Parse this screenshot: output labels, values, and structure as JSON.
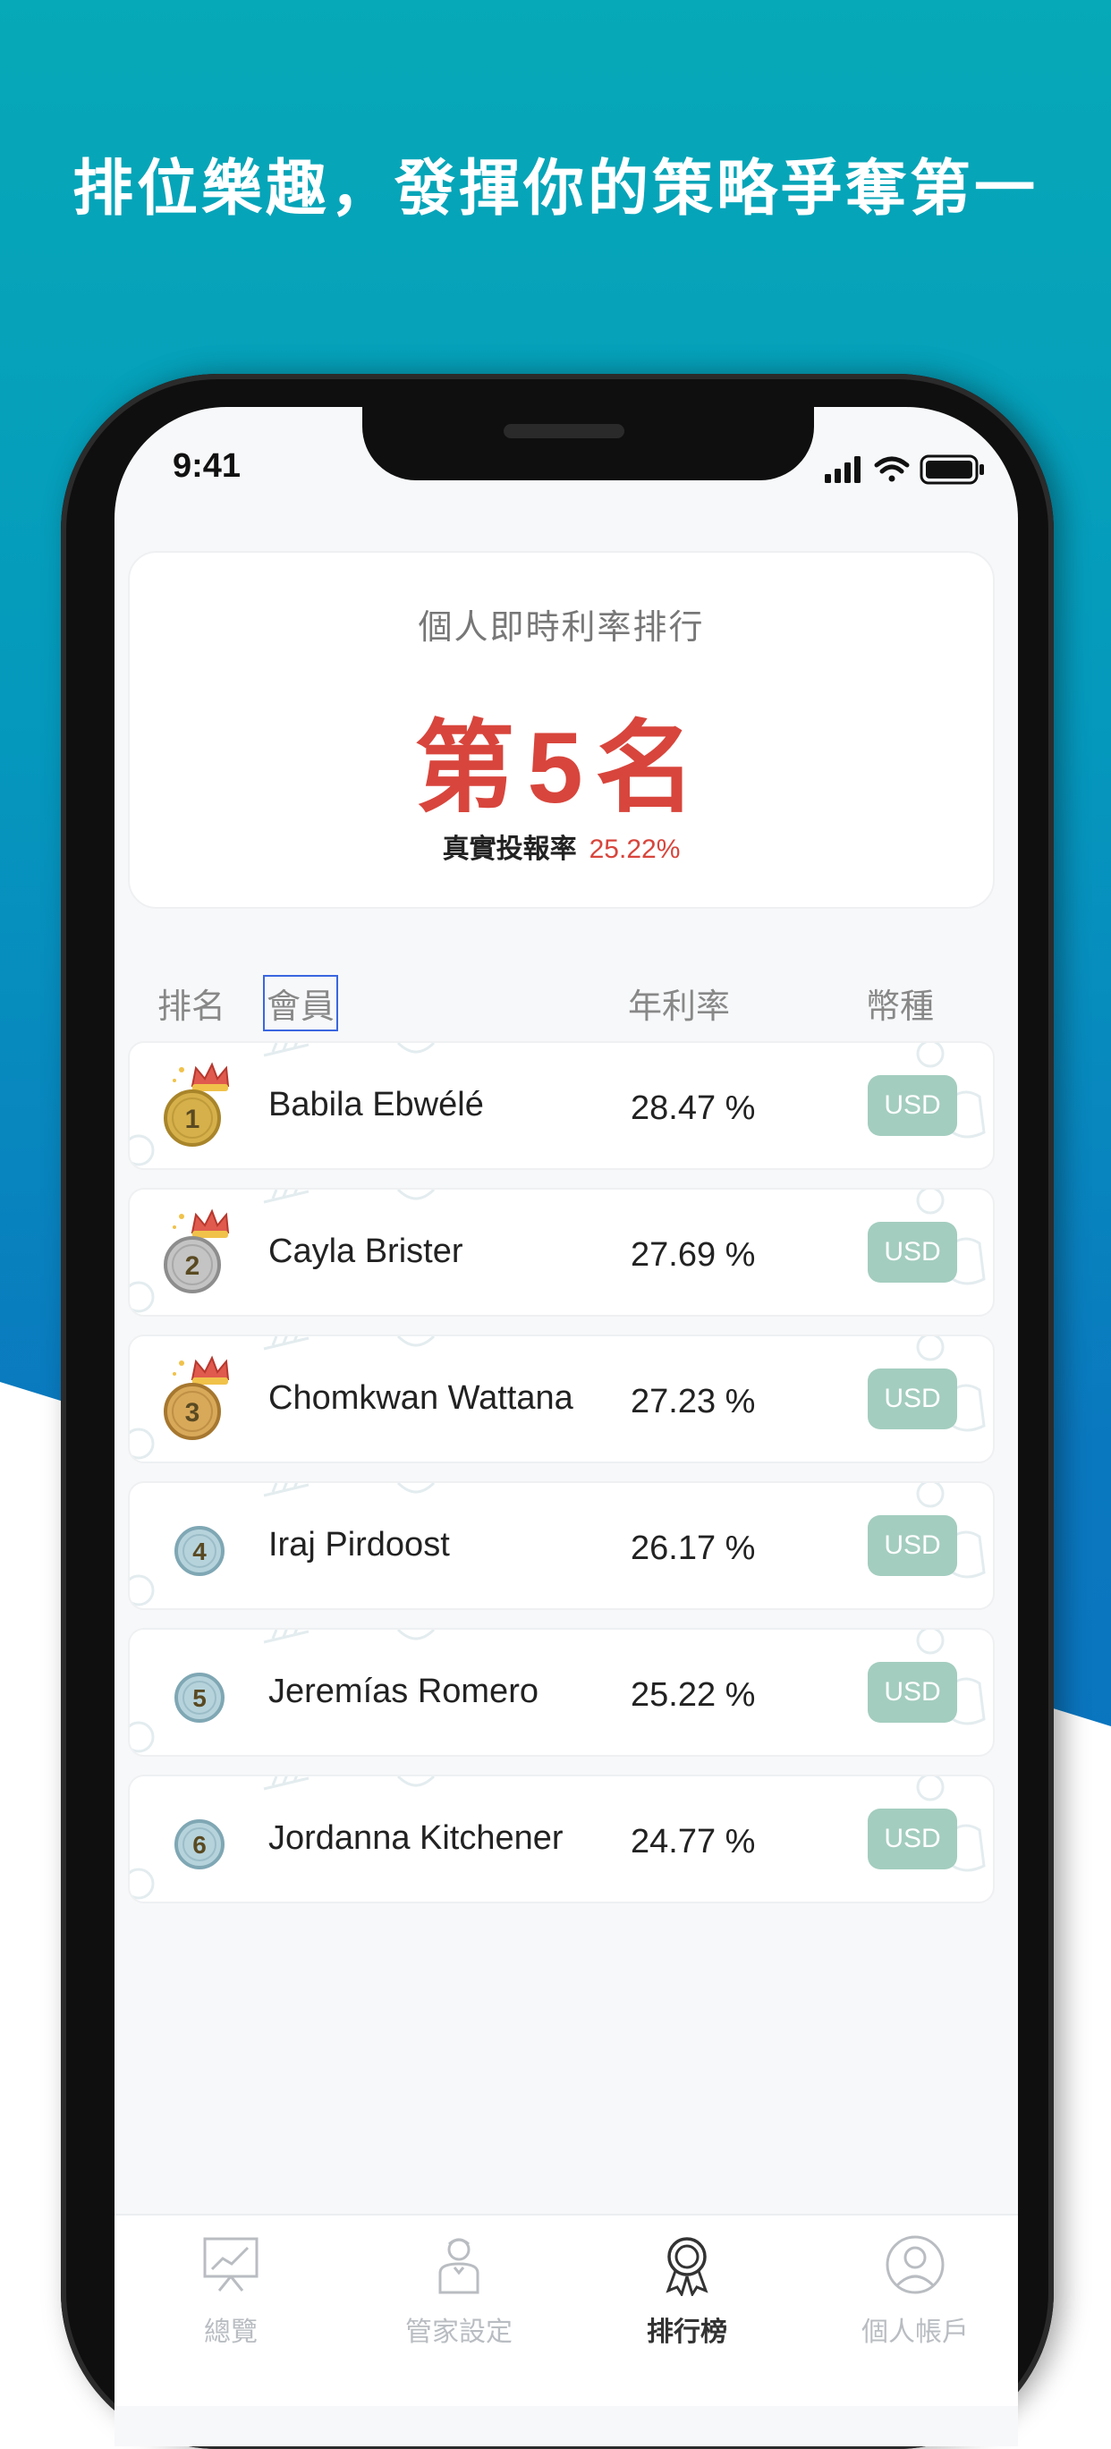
{
  "headline": "排位樂趣，發揮你的策略爭奪第一",
  "status_bar": {
    "time": "9:41"
  },
  "summary": {
    "title": "個人即時利率排行",
    "rank": "第5名",
    "return_label": "真實投報率",
    "return_value": "25.22%"
  },
  "table": {
    "headers": {
      "rank": "排名",
      "member": "會員",
      "rate": "年利率",
      "currency": "幣種"
    },
    "rows": [
      {
        "rank": "1",
        "medal": "gold-crown-medal",
        "name": "Babila Ebwélé",
        "rate": "28.47 %",
        "currency": "USD"
      },
      {
        "rank": "2",
        "medal": "silver-crown-medal",
        "name": "Cayla Brister",
        "rate": "27.69 %",
        "currency": "USD"
      },
      {
        "rank": "3",
        "medal": "bronze-crown-medal",
        "name": "Chomkwan Wattana",
        "rate": "27.23 %",
        "currency": "USD"
      },
      {
        "rank": "4",
        "medal": "blue-badge",
        "name": "Iraj Pirdoost",
        "rate": "26.17 %",
        "currency": "USD"
      },
      {
        "rank": "5",
        "medal": "blue-badge",
        "name": "Jeremías Romero",
        "rate": "25.22 %",
        "currency": "USD"
      },
      {
        "rank": "6",
        "medal": "blue-badge",
        "name": "Jordanna Kitchener",
        "rate": "24.77 %",
        "currency": "USD"
      }
    ]
  },
  "bottom_nav": [
    {
      "label": "總覽",
      "icon": "chart-board-icon",
      "active": false
    },
    {
      "label": "管家設定",
      "icon": "butler-icon",
      "active": false
    },
    {
      "label": "排行榜",
      "icon": "award-ribbon-icon",
      "active": true
    },
    {
      "label": "個人帳戶",
      "icon": "user-circle-icon",
      "active": false
    }
  ],
  "colors": {
    "accent_red": "#d8453c",
    "currency_badge": "#a3cdbf",
    "gold": "#d6b04a",
    "silver": "#b8b8b8",
    "bronze": "#d9a95a",
    "badge_blue": "#a9c9d3"
  }
}
